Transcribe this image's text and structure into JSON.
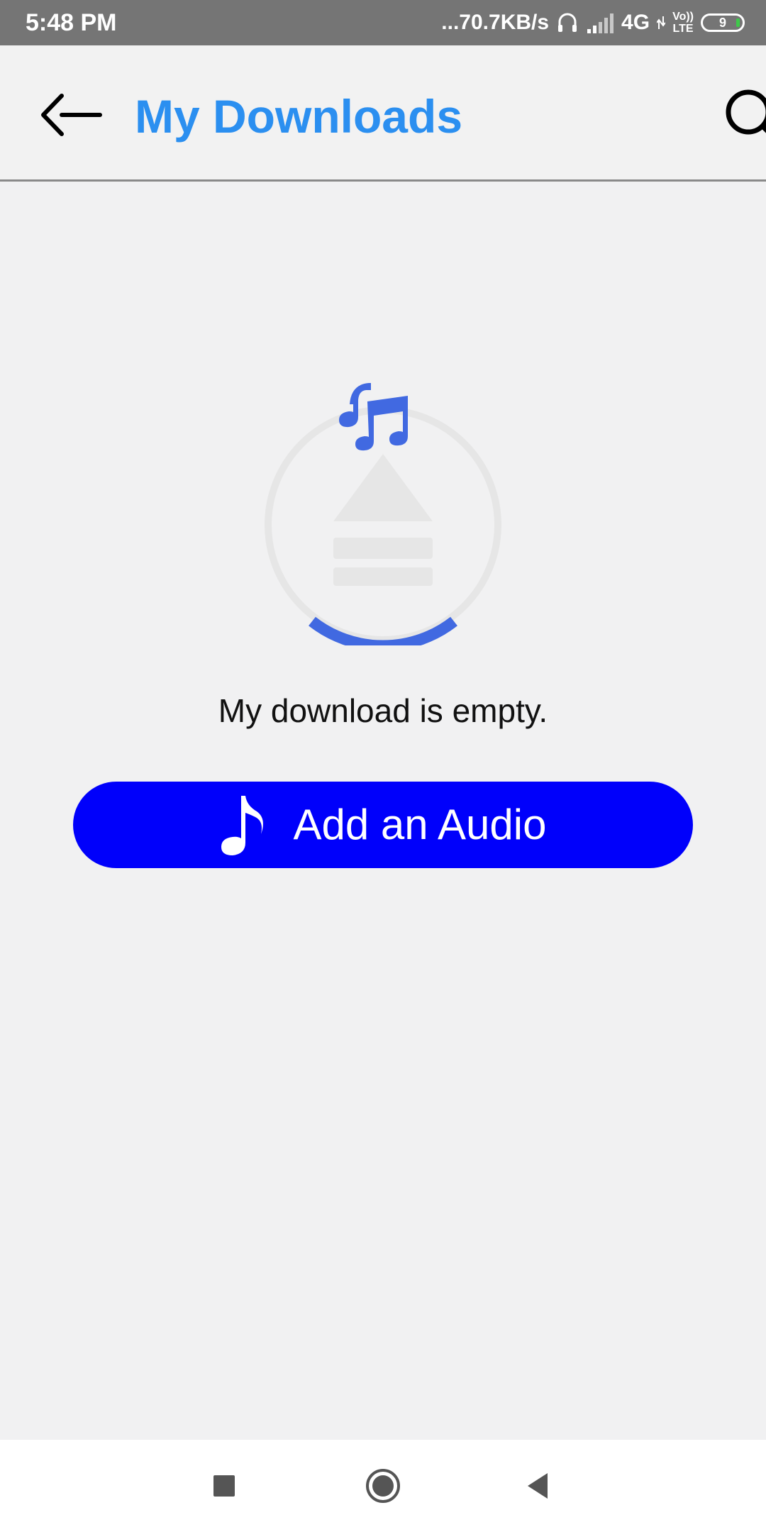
{
  "status_bar": {
    "time": "5:48 PM",
    "network_speed": "...70.7KB/s",
    "network_type": "4G",
    "volte_line1": "Vo))",
    "volte_line2": "LTE",
    "battery_level": "9",
    "icons": [
      "headphones-icon",
      "signal-icon",
      "data-arrows-icon",
      "battery-icon"
    ]
  },
  "header": {
    "title": "My Downloads",
    "back_icon": "back-arrow-icon",
    "search_icon": "search-icon",
    "title_color": "#2b8ff0"
  },
  "empty_state": {
    "illustration_icons": [
      "music-notes-icon",
      "eject-icon"
    ],
    "message": "My download is empty.",
    "accent_color": "#4169e1"
  },
  "actions": {
    "add_audio_label": "Add an Audio",
    "add_audio_icon": "music-note-icon",
    "button_color": "#0000fb"
  },
  "nav_bar": {
    "icons": [
      "recents-square-icon",
      "home-circle-icon",
      "back-triangle-icon"
    ]
  }
}
